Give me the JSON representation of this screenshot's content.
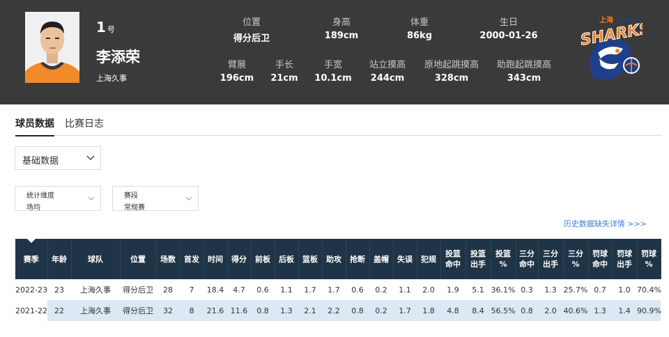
{
  "player": {
    "number": "1",
    "number_suffix": "号",
    "name": "李添荣",
    "team": "上海久事"
  },
  "stats_top": [
    {
      "label": "位置",
      "value": "得分后卫"
    },
    {
      "label": "身高",
      "value": "189cm"
    },
    {
      "label": "体重",
      "value": "86kg"
    },
    {
      "label": "生日",
      "value": "2000-01-26"
    }
  ],
  "stats_bottom": [
    {
      "label": "臂展",
      "value": "196cm"
    },
    {
      "label": "手长",
      "value": "21cm"
    },
    {
      "label": "手宽",
      "value": "10.1cm"
    },
    {
      "label": "站立摸高",
      "value": "244cm"
    },
    {
      "label": "原地起跳摸高",
      "value": "328cm"
    },
    {
      "label": "助跑起跳摸高",
      "value": "343cm"
    }
  ],
  "logo": {
    "text_top": "上海",
    "text_main": "SHARKS",
    "text_small": "SHARKS"
  },
  "tabs": [
    {
      "label": "球员数据",
      "active": true
    },
    {
      "label": "比赛日志",
      "active": false
    }
  ],
  "data_type_select": {
    "value": "基础数据"
  },
  "filters": [
    {
      "label": "统计维度",
      "value": "场均"
    },
    {
      "label": "赛段",
      "value": "常规赛"
    }
  ],
  "history_link": "历史数据缺失详情 >>>",
  "table": {
    "headers": [
      [
        "赛季"
      ],
      [
        "年龄"
      ],
      [
        "球队"
      ],
      [
        "位置"
      ],
      [
        "场数"
      ],
      [
        "首发"
      ],
      [
        "时间"
      ],
      [
        "得分"
      ],
      [
        "前板"
      ],
      [
        "后板"
      ],
      [
        "篮板"
      ],
      [
        "助攻"
      ],
      [
        "抢断"
      ],
      [
        "盖帽"
      ],
      [
        "失误"
      ],
      [
        "犯规"
      ],
      [
        "投篮",
        "命中"
      ],
      [
        "投篮",
        "出手"
      ],
      [
        "投篮",
        "%"
      ],
      [
        "三分",
        "命中"
      ],
      [
        "三分",
        "出手"
      ],
      [
        "三分",
        "%"
      ],
      [
        "罚球",
        "命中"
      ],
      [
        "罚球",
        "出手"
      ],
      [
        "罚球",
        "%"
      ]
    ],
    "rows": [
      [
        "2022-23",
        "23",
        "上海久事",
        "得分后卫",
        "28",
        "7",
        "18.4",
        "4.7",
        "0.6",
        "1.1",
        "1.7",
        "1.7",
        "0.6",
        "0.2",
        "1.1",
        "2.0",
        "1.9",
        "5.1",
        "36.1%",
        "0.3",
        "1.3",
        "25.7%",
        "0.7",
        "1.0",
        "70.4%"
      ],
      [
        "2021-22",
        "22",
        "上海久事",
        "得分后卫",
        "32",
        "8",
        "21.6",
        "11.6",
        "0.8",
        "1.3",
        "2.1",
        "2.2",
        "0.8",
        "0.2",
        "1.7",
        "1.8",
        "4.8",
        "8.4",
        "56.5%",
        "0.8",
        "2.0",
        "40.6%",
        "1.3",
        "1.4",
        "90.9%"
      ]
    ]
  },
  "colors": {
    "header_bg": "#3a3a3a",
    "table_header_bg": "#1f3446",
    "row_alt_bg": "#dce8f3",
    "link": "#3b7fd6",
    "logo_orange": "#f07d1f",
    "logo_blue": "#1f3f8a"
  }
}
